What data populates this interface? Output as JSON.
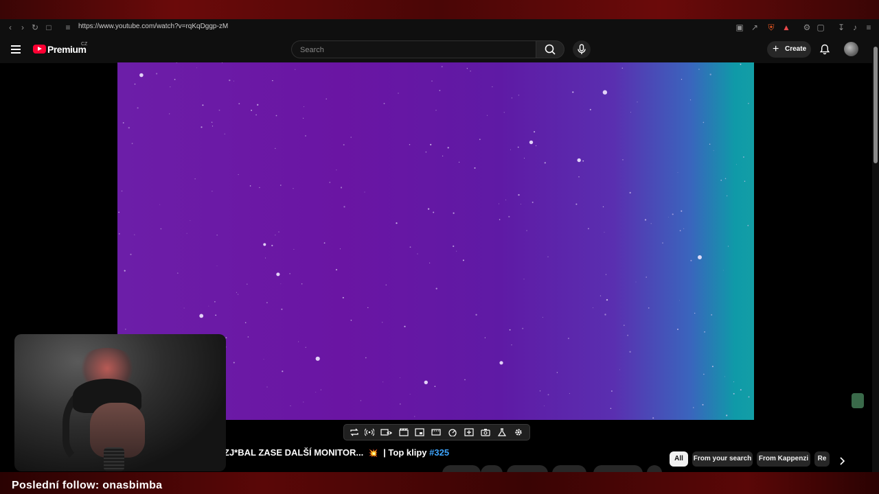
{
  "browser": {
    "url": "https://www.youtube.com/watch?v=rqKqDggp-zM"
  },
  "header": {
    "logo_text": "Premium",
    "country_code": "CZ",
    "search_placeholder": "Search",
    "create_label": "Create"
  },
  "video": {
    "title_main": "ZJ*BAL ZASE DALŠÍ MONITOR...",
    "title_emoji": "💥",
    "title_suffix": "| Top klipy",
    "title_tag": "#325"
  },
  "chips": [
    {
      "label": "All",
      "active": true
    },
    {
      "label": "From your search",
      "active": false
    },
    {
      "label": "From Kappenzi",
      "active": false
    },
    {
      "label": "Re",
      "active": false
    }
  ],
  "toolbar_icons": [
    "loop-icon",
    "broadcast-icon",
    "eye-icon",
    "clapper-icon",
    "picture-in-picture-icon",
    "cinema-icon",
    "speed-icon",
    "add-icon",
    "screenshot-icon",
    "flask-icon",
    "settings-icon"
  ],
  "overlay": {
    "last_follow": "Poslední follow: onasbimba"
  },
  "colors": {
    "youtube_red": "#ff0033",
    "link_blue": "#3ea6ff",
    "frame_red": "#5a0707"
  }
}
